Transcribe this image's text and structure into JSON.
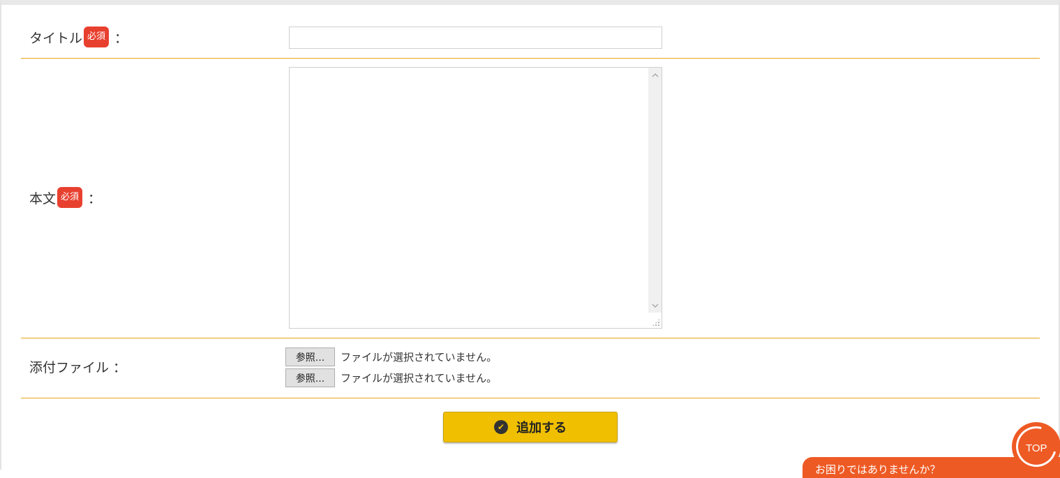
{
  "form": {
    "title_label": "タイトル",
    "body_label": "本文",
    "attachment_label": "添付ファイル",
    "required_badge": "必須",
    "colon": "：",
    "title_value": "",
    "body_value": "",
    "files": [
      {
        "button_label": "参照...",
        "status": "ファイルが選択されていません。"
      },
      {
        "button_label": "参照...",
        "status": "ファイルが選択されていません。"
      }
    ],
    "submit_label": "追加する"
  },
  "float": {
    "top_label": "TOP",
    "help_text": "お困りではありませんか？"
  },
  "colors": {
    "accent": "#f0c000",
    "divider": "#e8a21b",
    "badge": "#e8402f",
    "float": "#ee5a24"
  },
  "icons": {
    "submit": "check-circle-icon",
    "scroll_up": "chevron-up-icon",
    "scroll_down": "chevron-down-icon",
    "resize": "resize-grip-icon",
    "top": "arrow-circle-icon"
  }
}
